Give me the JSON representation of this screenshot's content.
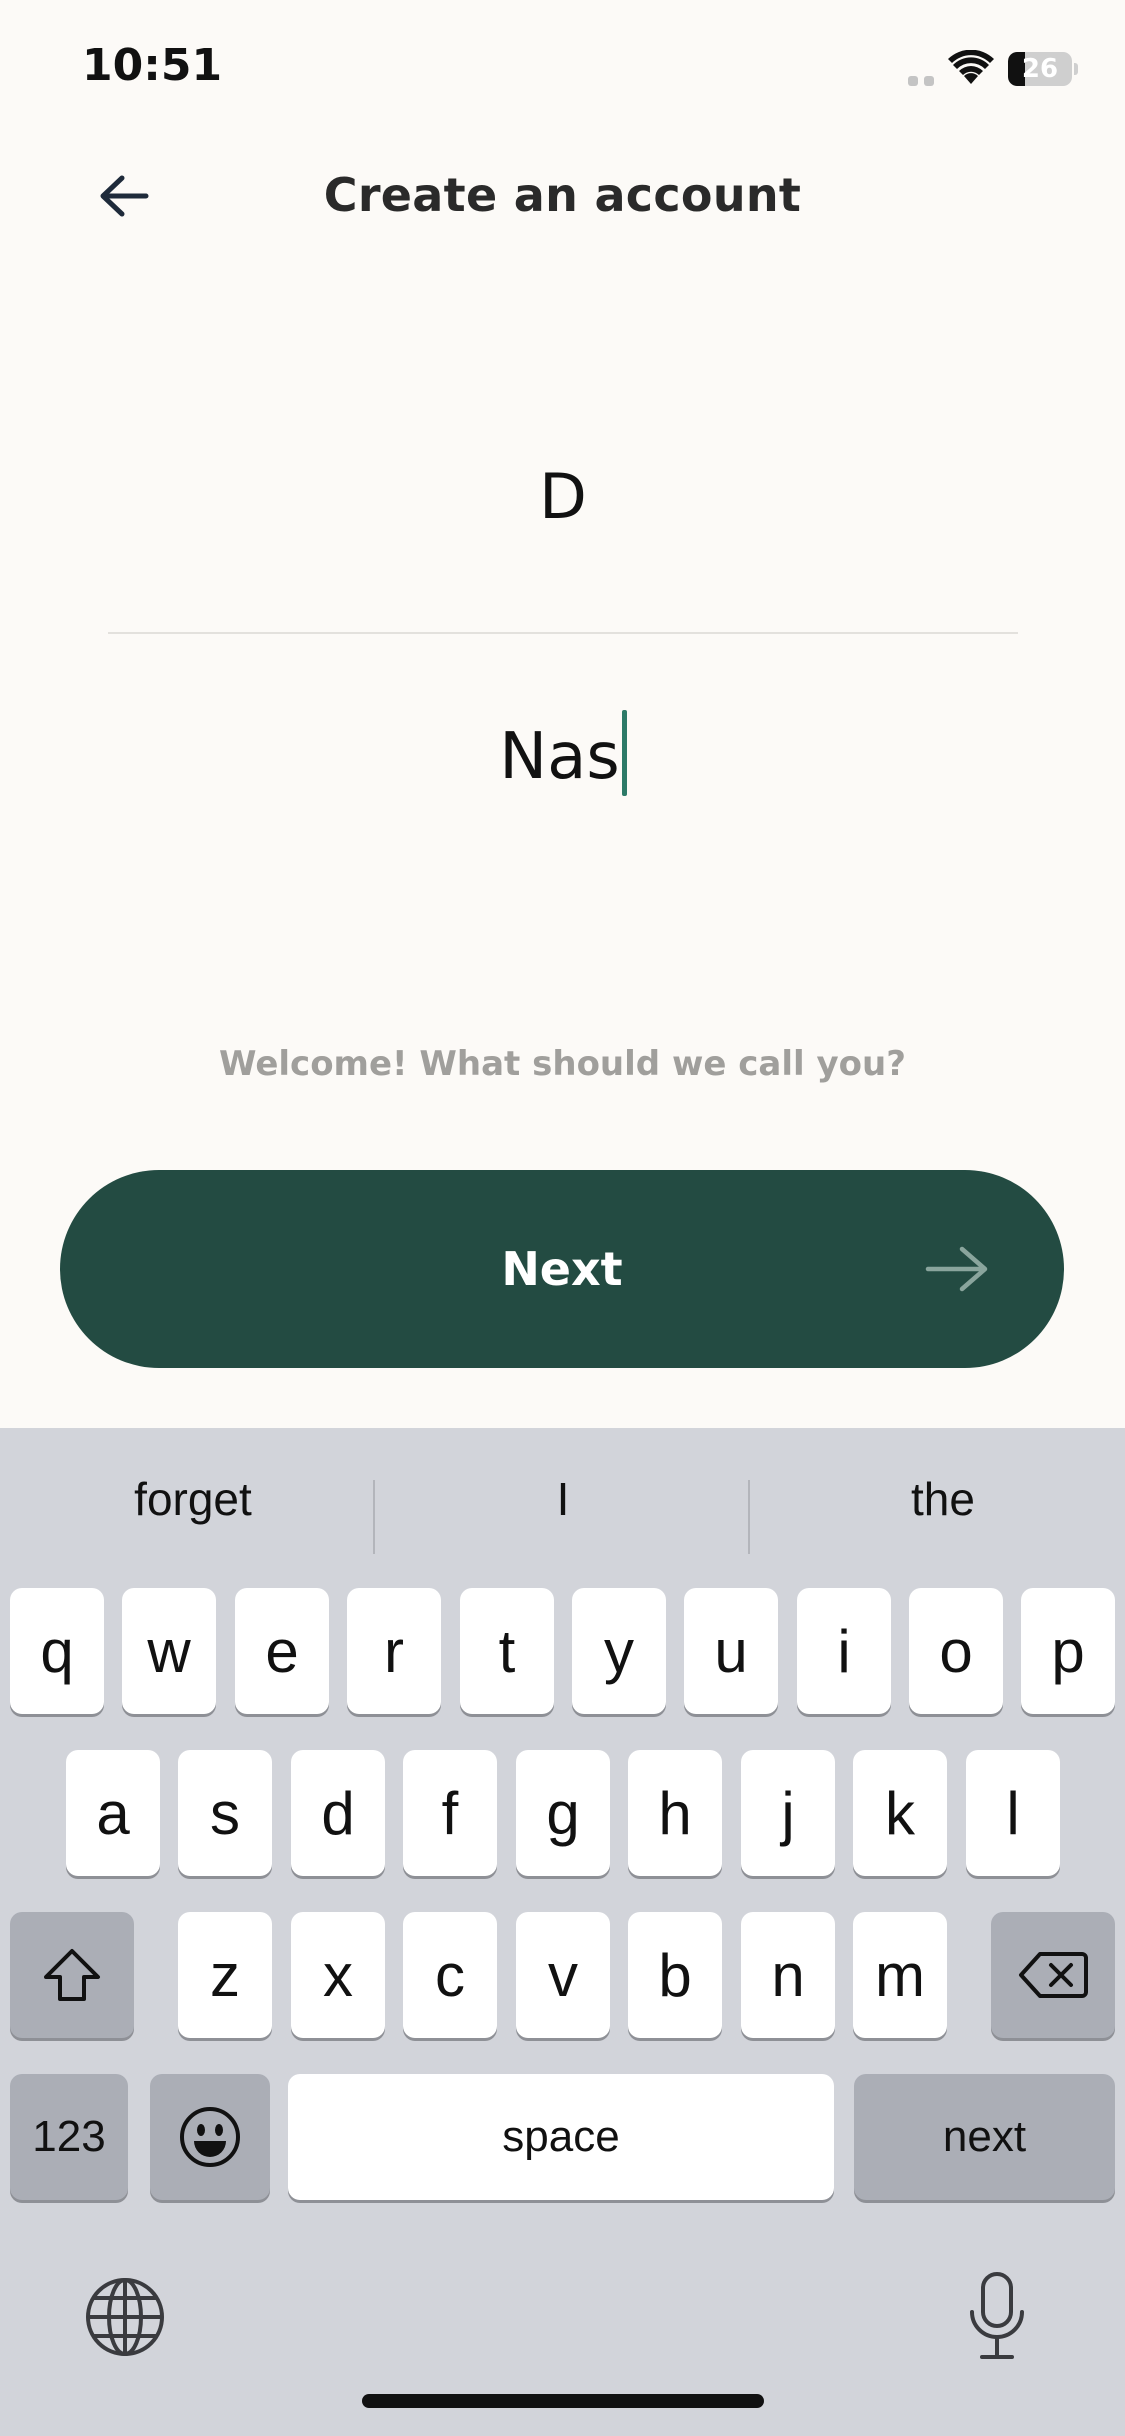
{
  "status_bar": {
    "time": "10:51",
    "battery": "26",
    "battery_percent": 26
  },
  "header": {
    "title": "Create an account",
    "back_icon": "arrow-left-icon"
  },
  "form": {
    "first_name": "D",
    "last_name": "Nas",
    "prompt": "Welcome! What should we call you?"
  },
  "next_button": {
    "label": "Next",
    "icon": "arrow-right-icon"
  },
  "keyboard": {
    "suggestions": [
      "forget",
      "I",
      "the"
    ],
    "row1": [
      "q",
      "w",
      "e",
      "r",
      "t",
      "y",
      "u",
      "i",
      "o",
      "p"
    ],
    "row2": [
      "a",
      "s",
      "d",
      "f",
      "g",
      "h",
      "j",
      "k",
      "l"
    ],
    "row3": [
      "z",
      "x",
      "c",
      "v",
      "b",
      "n",
      "m"
    ],
    "numbers_label": "123",
    "space_label": "space",
    "return_label": "next",
    "icons": [
      "shift-icon",
      "backspace-icon",
      "emoji-icon",
      "globe-icon",
      "microphone-icon"
    ]
  },
  "colors": {
    "accent": "#234b42",
    "caret": "#2d7a68",
    "background": "#fcfaf7",
    "keyboard": "#d2d4da"
  }
}
